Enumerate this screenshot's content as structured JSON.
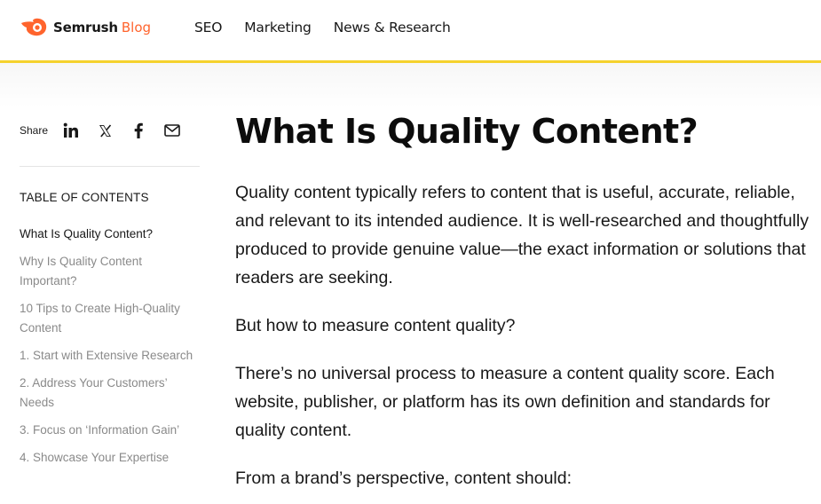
{
  "header": {
    "brand": "Semrush",
    "blog": "Blog",
    "nav": [
      "SEO",
      "Marketing",
      "News & Research"
    ],
    "accent_color": "#ff642d",
    "underline_color": "#f5d22e"
  },
  "share": {
    "label": "Share",
    "buttons": [
      "linkedin-icon",
      "x-icon",
      "facebook-icon",
      "mail-icon"
    ]
  },
  "toc": {
    "title": "TABLE OF CONTENTS",
    "items": [
      "What Is Quality Content?",
      "Why Is Quality Content Important?",
      "10 Tips to Create High-Quality Content",
      "1. Start with Extensive Research",
      "2. Address Your Customers’ Needs",
      "3. Focus on ‘Information Gain’",
      "4. Showcase Your Expertise"
    ]
  },
  "article": {
    "title": "What Is Quality Content?",
    "paragraphs": [
      "Quality content typically refers to content that is useful, accurate, reliable, and relevant to its intended audience. It is well-researched and thoughtfully produced to provide genuine value—the exact information or solutions that readers are seeking.",
      "But how to measure content quality?",
      "There’s no universal process to measure a content quality score. Each website, publisher, or platform has its own definition and standards for quality content.",
      "From a brand’s perspective, content should:"
    ]
  }
}
